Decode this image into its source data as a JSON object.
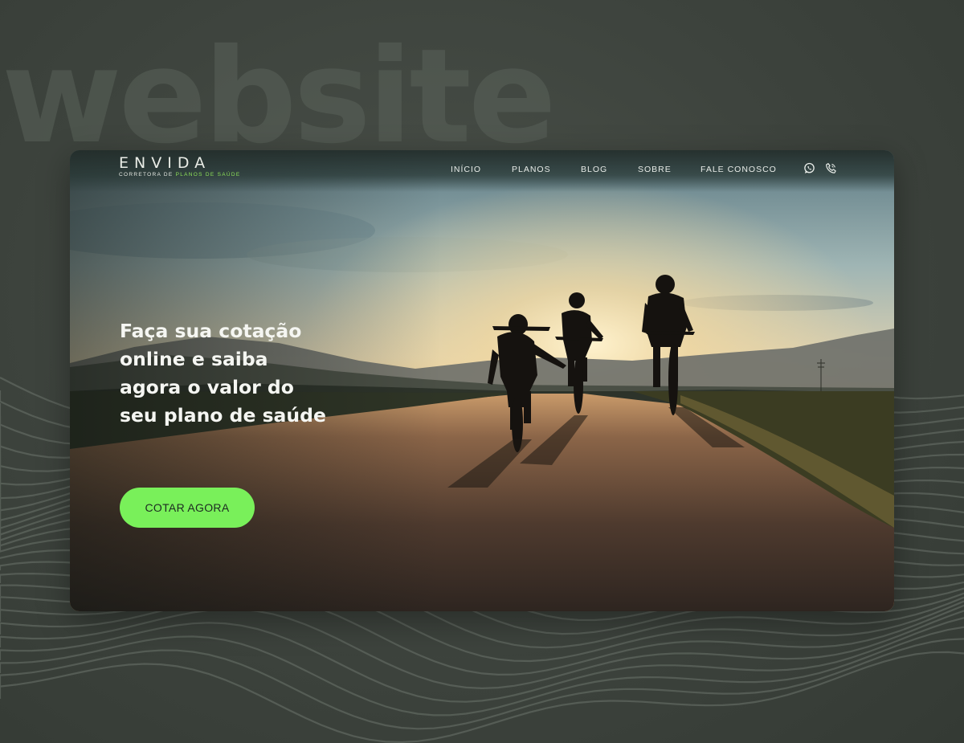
{
  "background": {
    "word": "website",
    "color": "#3d433d"
  },
  "site": {
    "logo": {
      "name": "ENVIDA",
      "tagline_prefix": "CORRETORA DE ",
      "tagline_accent": "PLANOS DE SAÚDE",
      "accent_color": "#8fe35a"
    },
    "nav": {
      "items": [
        {
          "label": "INÍCIO"
        },
        {
          "label": "PLANOS"
        },
        {
          "label": "BLOG"
        },
        {
          "label": "SOBRE"
        },
        {
          "label": "FALE CONOSCO"
        }
      ],
      "icons": [
        "whatsapp-icon",
        "phone-icon"
      ]
    },
    "hero": {
      "headline": "Faça sua cotação online e saiba agora o valor do seu plano de saúde",
      "cta_label": "COTAR AGORA",
      "cta_color": "#79f05a"
    }
  }
}
